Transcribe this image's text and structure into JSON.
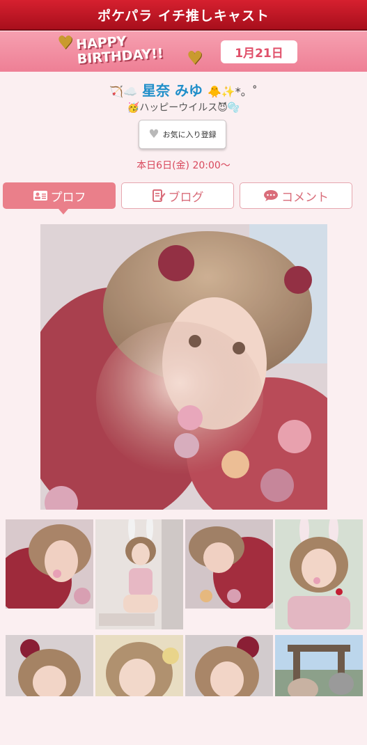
{
  "header": {
    "title": "ポケパラ イチ推しキャスト"
  },
  "birthday": {
    "banner_line1": "HAPPY",
    "banner_line2": "BIRTHDAY!!",
    "date": "1月21日"
  },
  "profile": {
    "name": "星奈 みゆ",
    "name_prefix": "🏹☁️",
    "name_suffix": "🐥✨*。˚",
    "tagline": "🥳ハッピーウイルス😈🫧",
    "favorite_label": "お気に入り登録",
    "schedule": "本日6日(金) 20:00〜"
  },
  "tabs": [
    {
      "label": "プロフ",
      "icon": "profile-card-icon",
      "active": true
    },
    {
      "label": "ブログ",
      "icon": "edit-note-icon",
      "active": false
    },
    {
      "label": "コメント",
      "icon": "speech-bubble-icon",
      "active": false
    }
  ],
  "colors": {
    "header_red": "#c8192a",
    "pink_accent": "#ea7f8a",
    "name_blue": "#1f8ec9",
    "schedule_red": "#d8485c"
  }
}
